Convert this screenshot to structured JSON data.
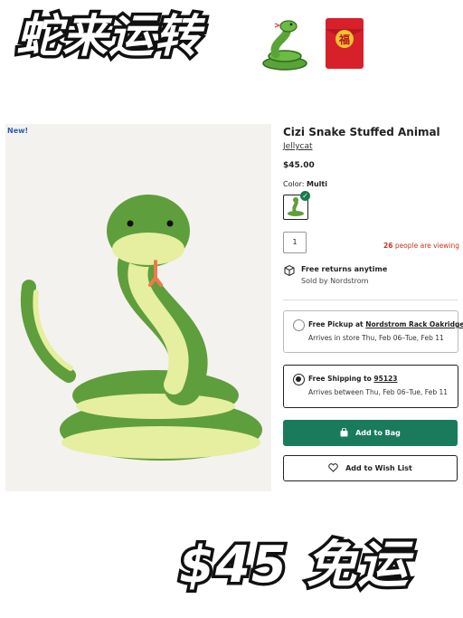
{
  "banner": {
    "top_text": "蛇来运转",
    "bottom_text": "$45 免运",
    "emoji_snake": "snake-emoji",
    "emoji_envelope": "red-envelope-emoji"
  },
  "product": {
    "new_tag": "New!",
    "title": "Cizi Snake Stuffed Animal",
    "brand": "Jellycat",
    "price": "$45.00",
    "color_label": "Color:",
    "color_value": "Multi",
    "quantity": "1",
    "viewing_count": "26",
    "viewing_text": " people are viewing",
    "returns": "Free returns anytime",
    "sold_by": "Sold by Nordstrom"
  },
  "fulfillment": {
    "pickup_title_prefix": "Free Pickup at ",
    "pickup_store": "Nordstrom Rack Oakridge",
    "pickup_sub": "Arrives in store Thu, Feb 06–Tue, Feb 11",
    "shipping_title_prefix": "Free Shipping to ",
    "shipping_zip": "95123",
    "shipping_sub": "Arrives between Thu, Feb 06–Tue, Feb 11",
    "selected": "shipping"
  },
  "actions": {
    "add_to_bag": "Add to Bag",
    "add_to_wishlist": "Add to Wish List"
  },
  "colors": {
    "primary_button": "#1a7a5c",
    "viewing_text": "#c8321f",
    "snake_green": "#5f9e3c",
    "snake_belly": "#e6eea0"
  }
}
